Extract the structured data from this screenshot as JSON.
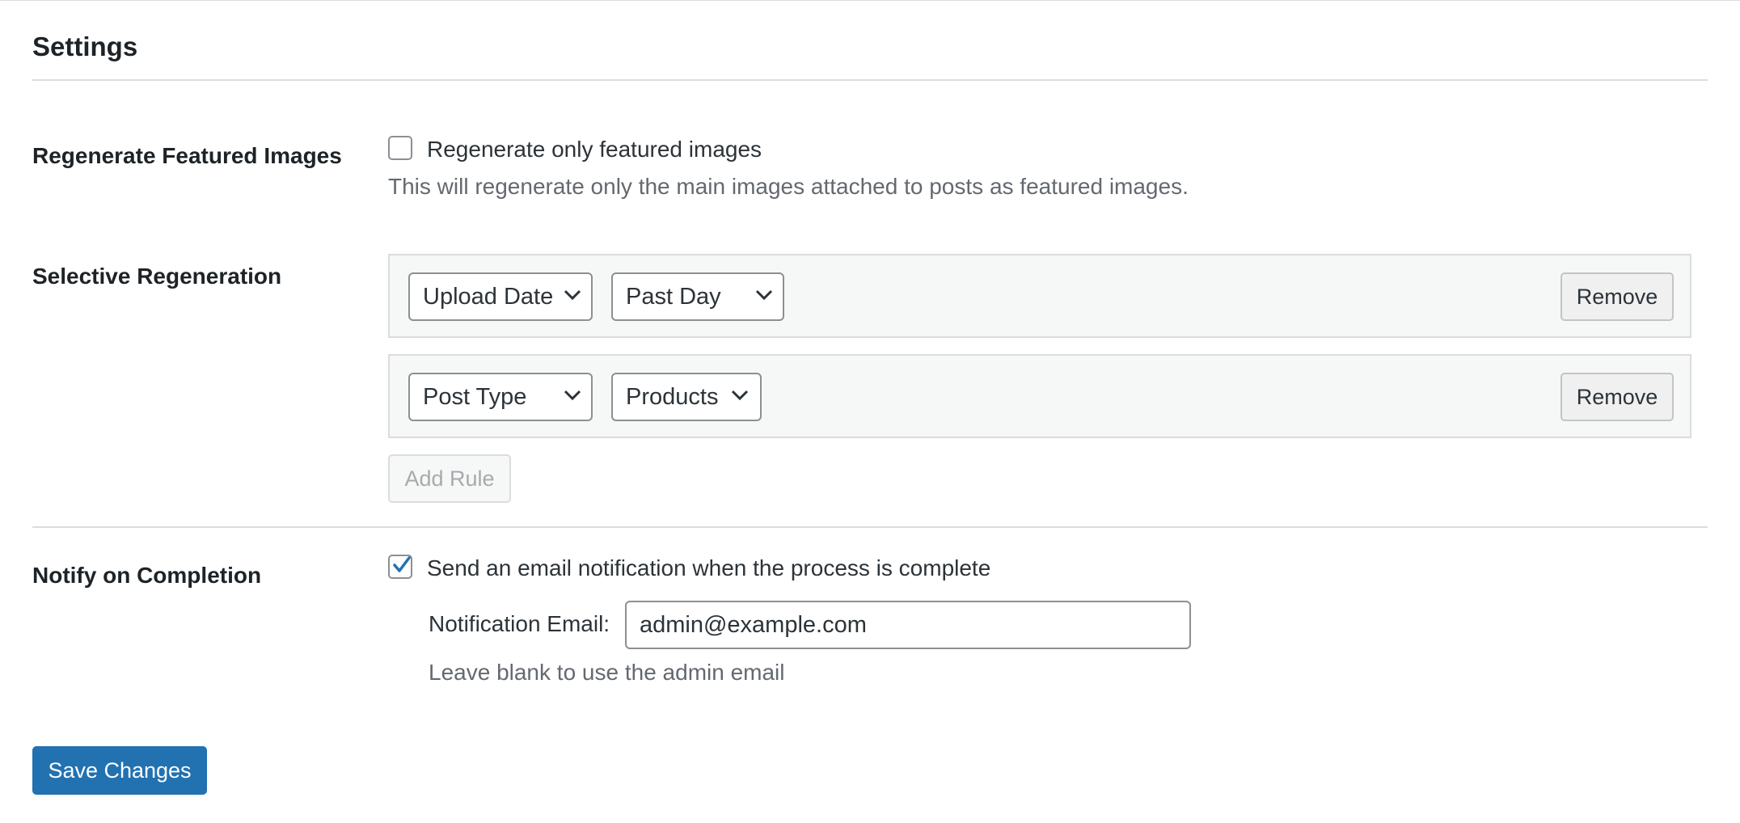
{
  "header": {
    "title": "Settings"
  },
  "featured": {
    "label": "Regenerate Featured Images",
    "checkbox_label": "Regenerate only featured images",
    "checked": false,
    "description": "This will regenerate only the main images attached to posts as featured images."
  },
  "selective": {
    "label": "Selective Regeneration",
    "rules": [
      {
        "field": "Upload Date",
        "value": "Past Day",
        "remove_label": "Remove"
      },
      {
        "field": "Post Type",
        "value": "Products",
        "remove_label": "Remove"
      }
    ],
    "add_rule_label": "Add Rule"
  },
  "notify": {
    "label": "Notify on Completion",
    "checkbox_label": "Send an email notification when the process is complete",
    "checked": true,
    "email_label": "Notification Email:",
    "email_value": "admin@example.com",
    "email_hint": "Leave blank to use the admin email"
  },
  "footer": {
    "save_label": "Save Changes"
  },
  "colors": {
    "primary": "#2271b1",
    "text": "#1d2327",
    "muted": "#646970",
    "border": "#dcdcde"
  },
  "icons": {
    "dropdown": "chevron-down-icon",
    "check": "checkmark-icon"
  }
}
